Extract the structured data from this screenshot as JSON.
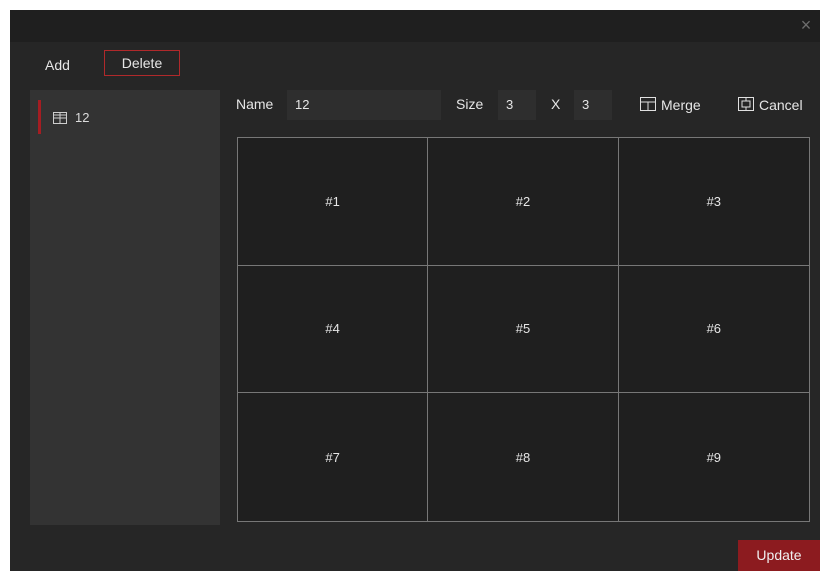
{
  "window": {
    "close_glyph": "×"
  },
  "toolbar": {
    "add_label": "Add",
    "delete_label": "Delete"
  },
  "sidebar": {
    "items": [
      {
        "label": "12",
        "icon": "layout-icon",
        "selected": true
      }
    ]
  },
  "form": {
    "name_label": "Name",
    "name_value": "12",
    "size_label": "Size",
    "size_rows": "3",
    "x_label": "X",
    "size_cols": "3",
    "merge_label": "Merge",
    "cancel_label": "Cancel"
  },
  "grid": {
    "cells": [
      "#1",
      "#2",
      "#3",
      "#4",
      "#5",
      "#6",
      "#7",
      "#8",
      "#9"
    ]
  },
  "footer": {
    "update_label": "Update"
  },
  "colors": {
    "accent": "#a51d22",
    "update_button": "#8c1b1f",
    "background": "#262626",
    "sidebar": "#333333"
  }
}
